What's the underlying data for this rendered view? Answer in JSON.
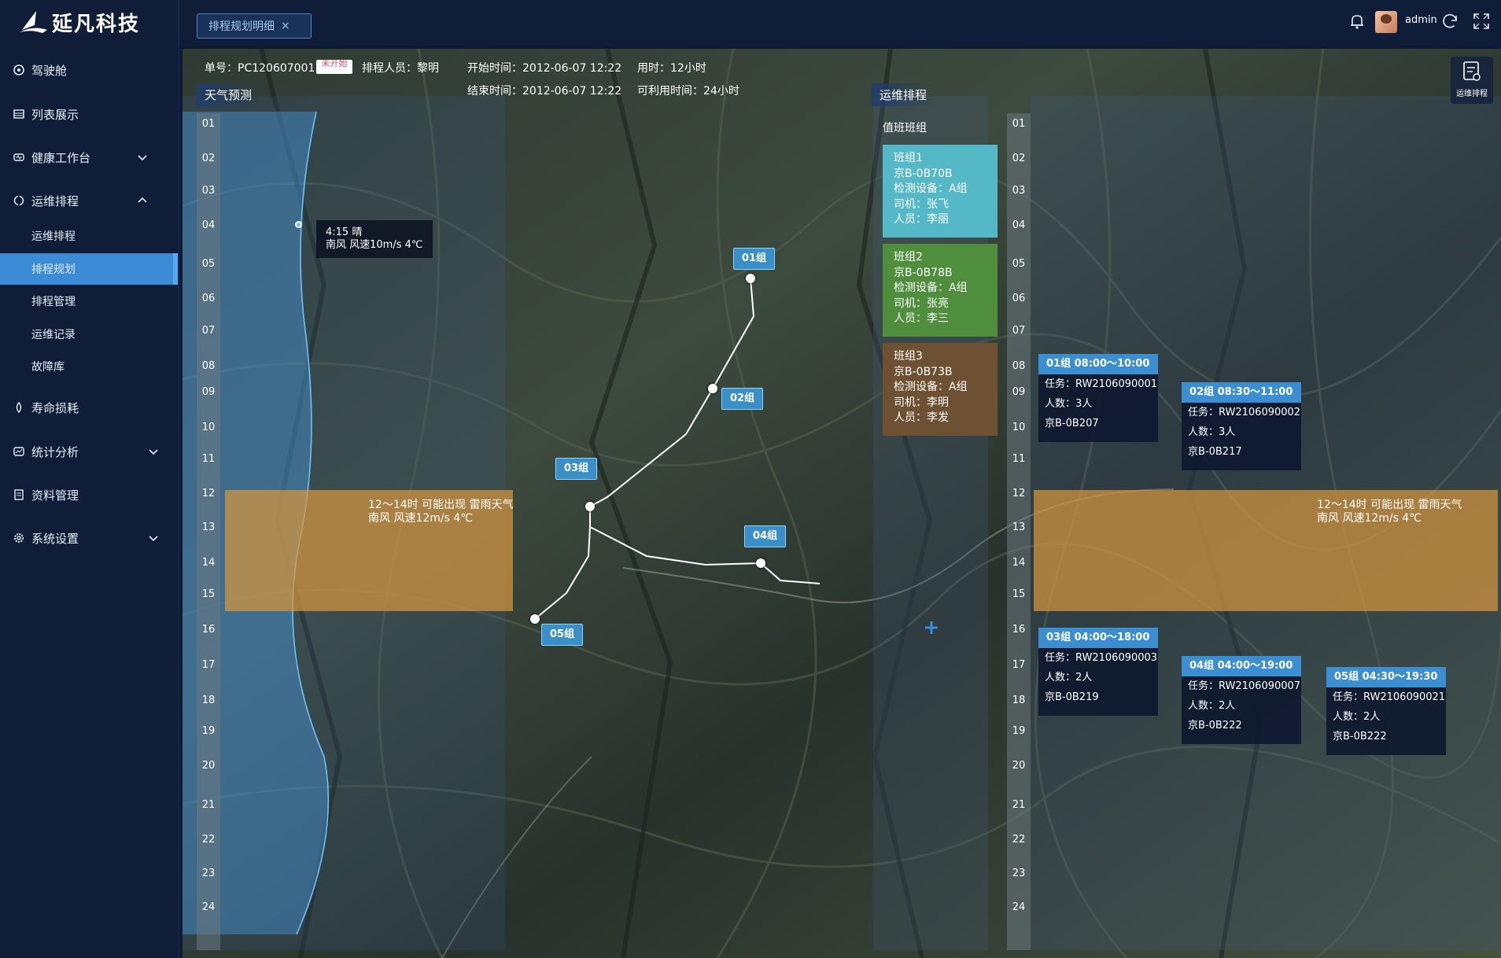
{
  "app": {
    "name": "延凡科技"
  },
  "sidebar": {
    "items": [
      {
        "label": "驾驶舱",
        "icon": "cockpit-icon"
      },
      {
        "label": "列表展示",
        "icon": "list-icon"
      },
      {
        "label": "健康工作台",
        "icon": "health-icon",
        "expandable": true
      },
      {
        "label": "运维排程",
        "icon": "maintenance-icon",
        "expandable": true,
        "expanded": true
      },
      {
        "label": "寿命损耗",
        "icon": "life-icon"
      },
      {
        "label": "统计分析",
        "icon": "stats-icon",
        "expandable": true
      },
      {
        "label": "资料管理",
        "icon": "document-icon"
      },
      {
        "label": "系统设置",
        "icon": "settings-icon",
        "expandable": true
      }
    ],
    "subitems": [
      {
        "label": "运维排程"
      },
      {
        "label": "排程规划",
        "active": true
      },
      {
        "label": "排程管理"
      },
      {
        "label": "运维记录"
      },
      {
        "label": "故障库"
      }
    ]
  },
  "header": {
    "tab_label": "排程规划明细",
    "tab_close": "×",
    "username": "admin"
  },
  "info": {
    "order_label": "单号：",
    "order_no": "PC120607001",
    "status_badge": "未开始",
    "scheduler_label": "排程人员：",
    "scheduler": "黎明",
    "start_label": "开始时间：",
    "start_time": "2012-06-07 12:22",
    "end_label": "结束时间：",
    "end_time": "2012-06-07 12:22",
    "duration_label": "用时：",
    "duration": "12小时",
    "available_label": "可利用时间：",
    "available": "24小时"
  },
  "weather": {
    "title": "天气预测",
    "point_note_line1": "4:15 晴",
    "point_note_line2": "南风 风速10m/s  4℃",
    "storm_line1": "12～14时 可能出现 雷雨天气",
    "storm_line2": "南风 风速12m/s  4℃"
  },
  "hours": [
    "01",
    "02",
    "03",
    "04",
    "05",
    "06",
    "07",
    "08",
    "09",
    "10",
    "11",
    "12",
    "13",
    "14",
    "15",
    "16",
    "17",
    "18",
    "19",
    "20",
    "21",
    "22",
    "23",
    "24"
  ],
  "routes": {
    "groups": [
      "01组",
      "02组",
      "03组",
      "04组",
      "05组"
    ]
  },
  "schedule": {
    "title": "运维排程",
    "team_header": "值班班组",
    "floating_button_label": "运维排程",
    "teams": [
      {
        "name": "班组1",
        "plate": "京B-0B70B",
        "equipment": "检测设备：A组",
        "driver": "司机：张飞",
        "staff": "人员：李丽",
        "color": "#55b8c6"
      },
      {
        "name": "班组2",
        "plate": "京B-0B78B",
        "equipment": "检测设备：A组",
        "driver": "司机：张亮",
        "staff": "人员：李三",
        "color": "#4e8e3c"
      },
      {
        "name": "班组3",
        "plate": "京B-0B73B",
        "equipment": "检测设备：A组",
        "driver": "司机：李明",
        "staff": "人员：李发",
        "color": "#6e5032"
      }
    ],
    "tasks": [
      {
        "head": "01组  08:00～10:00",
        "task": "任务：RW2106090001",
        "count": "人数：3人",
        "plate": "京B-0B207"
      },
      {
        "head": "02组  08:30～11:00",
        "task": "任务：RW2106090002",
        "count": "人数：3人",
        "plate": "京B-0B217"
      },
      {
        "head": "03组  04:00～18:00",
        "task": "任务：RW2106090003",
        "count": "人数：2人",
        "plate": "京B-0B219"
      },
      {
        "head": "04组  04:00～19:00",
        "task": "任务：RW2106090007",
        "count": "人数：2人",
        "plate": "京B-0B222"
      },
      {
        "head": "05组  04:30～19:30",
        "task": "任务：RW2106090021",
        "count": "人数：2人",
        "plate": "京B-0B222"
      }
    ],
    "storm_line1": "12～14时 可能出现 雷雨天气",
    "storm_line2": "南风 风速12m/s  4℃"
  },
  "colors": {
    "accent": "#3b8bd6",
    "storm": "#d6963e",
    "sidebar_bg": "#0f1d38"
  }
}
